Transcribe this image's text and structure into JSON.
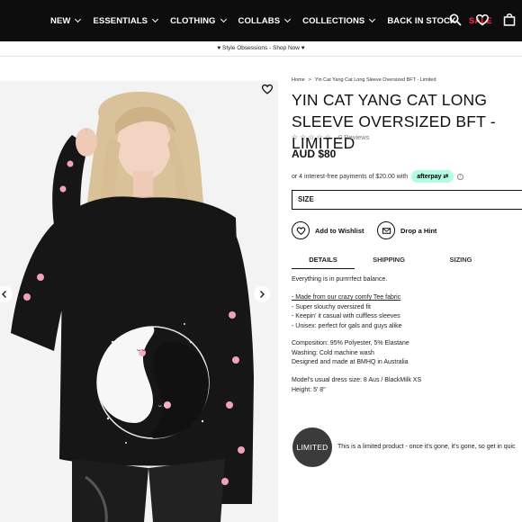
{
  "nav": {
    "items": [
      {
        "label": "NEW"
      },
      {
        "label": "ESSENTIALS"
      },
      {
        "label": "CLOTHING"
      },
      {
        "label": "COLLABS"
      },
      {
        "label": "COLLECTIONS"
      },
      {
        "label": "BACK IN STOCK"
      },
      {
        "label": "SALE"
      }
    ],
    "sale_color": "#ff2b4a",
    "icons": [
      "search-icon",
      "heart-icon",
      "bag-icon"
    ]
  },
  "promo": {
    "text": "♥ Style Obsessions - Shop Now ♥"
  },
  "gallery": {
    "image": "woman in black long sleeve yin yang cat tee",
    "prev_icon": "chevron-left-icon",
    "next_icon": "chevron-right-icon"
  },
  "breadcrumb": {
    "home": "Home",
    "separator": ">",
    "current": "Yin Cat Yang Cat Long Sleeve Oversized BFT - Limited"
  },
  "product": {
    "title": "YIN CAT YANG CAT LONG SLEEVE OVERSIZED BFT - LIMITED",
    "rating_stars": 0,
    "reviews": "0 Reviews",
    "price": "AUD $80",
    "afterpay_text": "or 4 interest-free payments of $20.00 with",
    "afterpay_badge": "afterpay",
    "size_label": "SIZE",
    "wishlist_label": "Add to Wishlist",
    "hint_label": "Drop a Hint"
  },
  "tabs": [
    {
      "label": "DETAILS",
      "active": true
    },
    {
      "label": "SHIPPING",
      "active": false
    },
    {
      "label": "SIZING",
      "active": false
    }
  ],
  "details": {
    "intro": "Everything is in purrrrfect balance.",
    "bullets": [
      "- Made from our crazy comfy Tee fabric",
      "- Super slouchy oversized fit",
      "- Keepin' it casual with cuffless sleeves",
      "- Unisex: perfect for gals and guys alike"
    ],
    "composition": "Composition: 95% Polyester, 5% Elastane",
    "washing": "Washing: Cold machine wash",
    "made": "Designed and made at BMHQ in Australia",
    "model_size": "Model's usual dress size: 8 Aus / BlackMilk XS",
    "height": "Height: 5' 8\""
  },
  "limited": {
    "badge": "LIMITED",
    "text": "This is a limited product - once it's gone, it's gone, so get in quic"
  }
}
